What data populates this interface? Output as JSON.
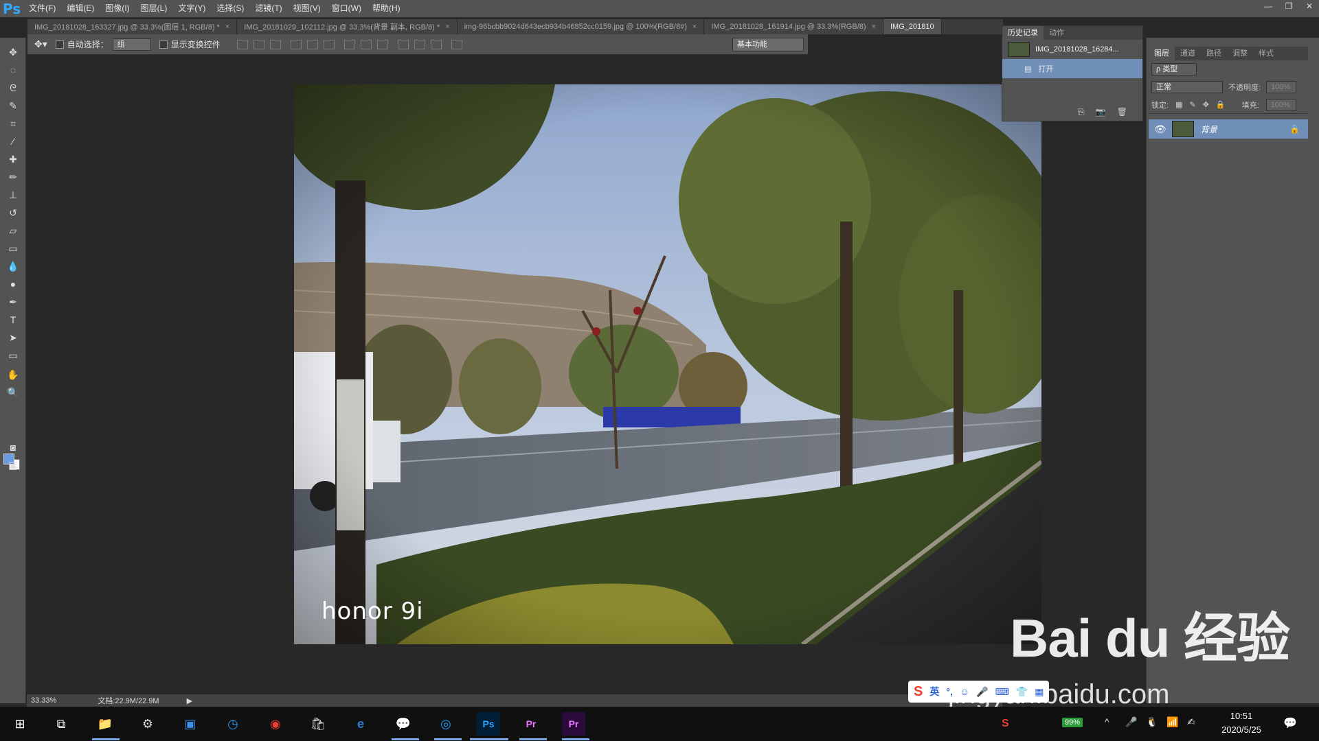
{
  "app": {
    "logo": "Ps",
    "menu": [
      "文件(F)",
      "编辑(E)",
      "图像(I)",
      "图层(L)",
      "文字(Y)",
      "选择(S)",
      "滤镜(T)",
      "视图(V)",
      "窗口(W)",
      "帮助(H)"
    ]
  },
  "tabs": [
    {
      "label": "IMG_20181028_163327.jpg @ 33.3%(图层 1, RGB/8) *",
      "active": false
    },
    {
      "label": "IMG_20181029_102112.jpg @ 33.3%(背景 副本, RGB/8) *",
      "active": false
    },
    {
      "label": "img-96bcbb9024d643ecb934b46852cc0159.jpg @ 100%(RGB/8#)",
      "active": false
    },
    {
      "label": "IMG_20181028_161914.jpg @ 33.3%(RGB/8)",
      "active": false
    },
    {
      "label": "IMG_201810",
      "active": true
    }
  ],
  "options": {
    "auto_select_label": "自动选择：",
    "auto_select_value": "组",
    "show_transform_label": "显示变换控件",
    "workspace": "基本功能"
  },
  "history": {
    "tabs": [
      "历史记录",
      "动作"
    ],
    "snapshot_label": "IMG_20181028_16284...",
    "step_label": "打开"
  },
  "layers": {
    "tabs": [
      "图层",
      "通道",
      "路径",
      "调整",
      "样式"
    ],
    "kind_label": "ρ 类型",
    "blend_mode": "正常",
    "opacity_label": "不透明度:",
    "opacity_value": "100%",
    "lock_label": "锁定:",
    "fill_label": "填充:",
    "fill_value": "100%",
    "layer_name": "背景"
  },
  "photo": {
    "watermark": "honor 9i"
  },
  "status": {
    "zoom": "33.33%",
    "doc": "文档:22.9M/22.9M"
  },
  "taskbar": {
    "battery": "99%",
    "time": "10:51",
    "date": "2020/5/25",
    "ime_label": "英"
  },
  "watermark": {
    "baidu": "Bai du 经验",
    "url": "jingyan.baidu.com"
  }
}
